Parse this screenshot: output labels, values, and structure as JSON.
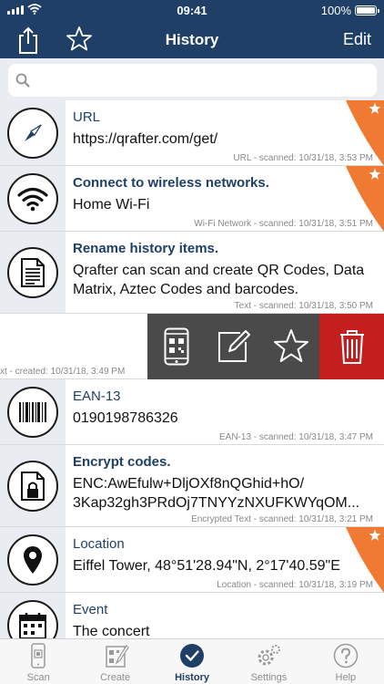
{
  "status": {
    "time": "09:41",
    "battery": "100%"
  },
  "nav": {
    "title": "History",
    "edit_label": "Edit"
  },
  "search": {
    "placeholder": ""
  },
  "items": [
    {
      "title": "URL",
      "content": "https://qrafter.com/get/",
      "meta": "URL - scanned: 10/31/18, 3:53 PM",
      "icon": "compass-icon",
      "favorite": true
    },
    {
      "title": "Connect to wireless networks.",
      "content": "Home Wi-Fi",
      "meta": "Wi-Fi Network - scanned: 10/31/18, 3:51 PM",
      "icon": "wifi-icon",
      "favorite": true
    },
    {
      "title": "Rename history items.",
      "content": "Qrafter can scan and create QR Codes, Data Matrix, Aztec Codes and barcodes.",
      "meta": "Text - scanned: 10/31/18, 3:50 PM",
      "icon": "document-icon",
      "favorite": false
    },
    {
      "title": "",
      "content": "",
      "meta": "xt - created: 10/31/18, 3:49 PM",
      "icon": "",
      "favorite": false
    },
    {
      "title": "EAN-13",
      "content": "0190198786326",
      "meta": "EAN-13 - scanned: 10/31/18, 3:47 PM",
      "icon": "barcode-icon",
      "favorite": false
    },
    {
      "title": "Encrypt codes.",
      "content": "ENC:AwEfulw+DljOXf8nQGhid+hO/ 3Kap32gh3PRdOj7TNYYzNXUFKWYqOM...",
      "meta": "Encrypted Text - scanned: 10/31/18, 3:21 PM",
      "icon": "encrypted-file-icon",
      "favorite": false
    },
    {
      "title": "Location",
      "content": "Eiffel Tower, 48°51'28.94\"N, 2°17'40.59\"E",
      "meta": "Location - scanned: 10/31/18, 3:19 PM",
      "icon": "location-pin-icon",
      "favorite": true
    },
    {
      "title": "Event",
      "content": "The concert",
      "meta": "",
      "icon": "calendar-icon",
      "favorite": false
    }
  ],
  "tabs": [
    {
      "label": "Scan",
      "icon": "phone-scan-icon"
    },
    {
      "label": "Create",
      "icon": "create-code-icon"
    },
    {
      "label": "History",
      "icon": "checkmark-icon",
      "active": true
    },
    {
      "label": "Settings",
      "icon": "gear-icon"
    },
    {
      "label": "Help",
      "icon": "question-icon"
    }
  ],
  "colors": {
    "nav": "#1f3f67",
    "accent": "#f07a32",
    "delete": "#c51e1e",
    "swipe_action": "#4a4a4a"
  }
}
